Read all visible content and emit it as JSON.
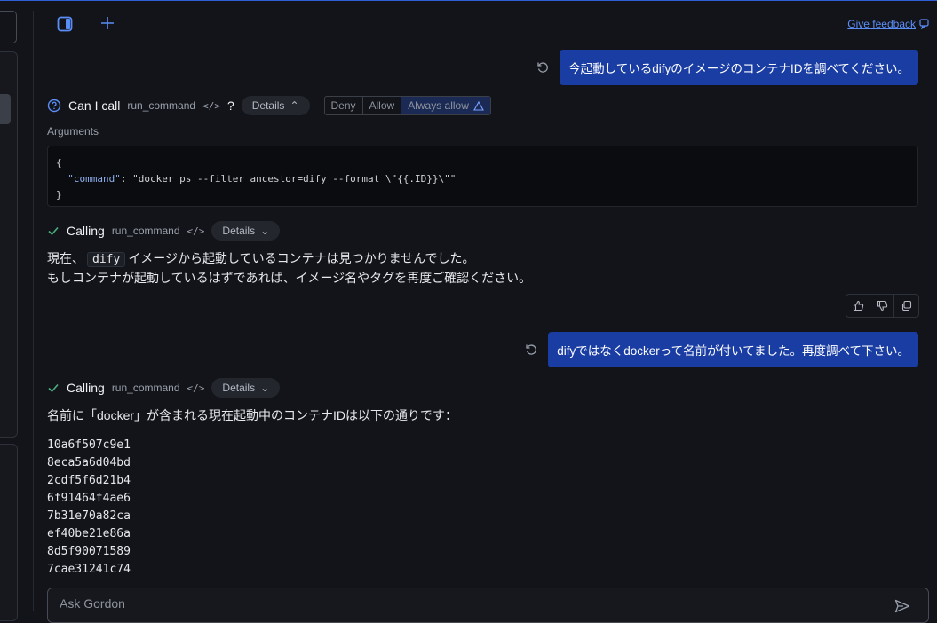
{
  "toolbar": {
    "sidebar_toggle_icon": "sidebar-toggle-icon",
    "new_chat_icon": "plus-icon",
    "feedback_label": "Give feedback"
  },
  "messages": {
    "user1": "今起動しているdifyのイメージのコンテナIDを調べてください。",
    "ask": {
      "title": "Can I call",
      "command": "run_command",
      "question_mark": "?",
      "details_label": "Details",
      "deny_label": "Deny",
      "allow_label": "Allow",
      "always_allow_label": "Always allow"
    },
    "arguments_label": "Arguments",
    "args_code": {
      "open": "{",
      "key": "\"command\"",
      "value": ": \"docker ps --filter ancestor=dify --format \\\"{{.ID}}\\\"\"",
      "close": "}"
    },
    "call1": {
      "title": "Calling",
      "command": "run_command",
      "details_label": "Details"
    },
    "reply1": {
      "line1_pre": "現在、",
      "line1_code": "dify",
      "line1_post": "イメージから起動しているコンテナは見つかりませんでした。",
      "line2": "もしコンテナが起動しているはずであれば、イメージ名やタグを再度ご確認ください。"
    },
    "user2": "difyではなくdockerって名前が付いてました。再度調べて下さい。",
    "call2": {
      "title": "Calling",
      "command": "run_command",
      "details_label": "Details"
    },
    "reply2": {
      "intro": "名前に「docker」が含まれる現在起動中のコンテナIDは以下の通りです：",
      "ids": [
        "10a6f507c9e1",
        "8eca5a6d04bd",
        "2cdf5f6d21b4",
        "6f91464f4ae6",
        "7b31e70a82ca",
        "ef40be21e86a",
        "8d5f90071589",
        "7cae31241c74"
      ]
    }
  },
  "composer": {
    "placeholder": "Ask Gordon"
  },
  "colors": {
    "accent": "#5b8df6",
    "user_bubble": "#1a3da3",
    "background": "#121419",
    "success": "#4caf7d"
  }
}
